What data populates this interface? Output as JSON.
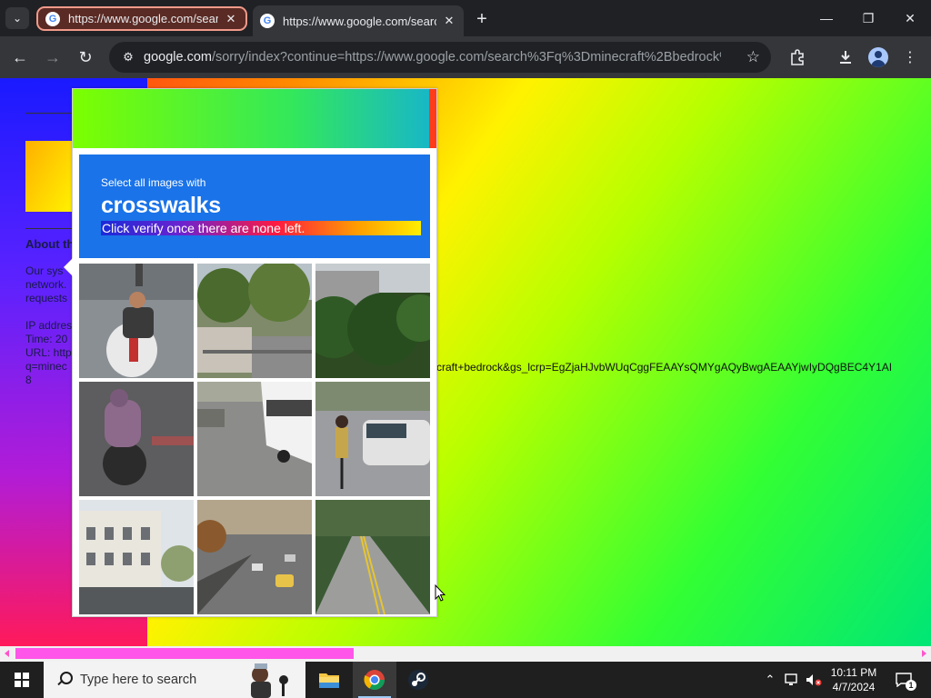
{
  "browser": {
    "tabs": [
      {
        "title": "https://www.google.com/search?q",
        "close": "✕"
      },
      {
        "title": "https://www.google.com/search?q",
        "close": "✕"
      }
    ],
    "new_tab": "+",
    "url_host": "google.com",
    "url_path": "/sorry/index?continue=https://www.google.com/search%3Fq%3Dminecraft%2Bbedrock%2B...",
    "window": {
      "minimize": "—",
      "restore": "❐",
      "close": "✕"
    }
  },
  "page": {
    "heading": "About th",
    "paragraph": [
      "Our sys",
      "network.",
      "requests"
    ],
    "details": [
      "IP addres",
      "Time: 20",
      "URL: http",
      "q=minec",
      "8"
    ],
    "url_overflow": "craft+bedrock&gs_lcrp=EgZjaHJvbWUqCggFEAAYsQMYgAQyBwgAEAAYjwIyDQgBEC4Y1AI"
  },
  "captcha": {
    "instruction_line1": "Select all images with",
    "instruction_target": "crosswalks",
    "instruction_line3": "Click verify once there are none left.",
    "tiles": [
      {
        "name": "scooter-rider"
      },
      {
        "name": "street-trees"
      },
      {
        "name": "hedge-building"
      },
      {
        "name": "moped-rider"
      },
      {
        "name": "bus-road"
      },
      {
        "name": "cyclist-car"
      },
      {
        "name": "building-facade"
      },
      {
        "name": "highway-traffic"
      },
      {
        "name": "country-road"
      }
    ]
  },
  "taskbar": {
    "search_placeholder": "Type here to search",
    "time": "10:11 PM",
    "date": "4/7/2024",
    "notification_count": "1"
  },
  "colors": {
    "captcha_blue": "#1a73e8",
    "scrollbar_thumb": "#ff55e8"
  }
}
